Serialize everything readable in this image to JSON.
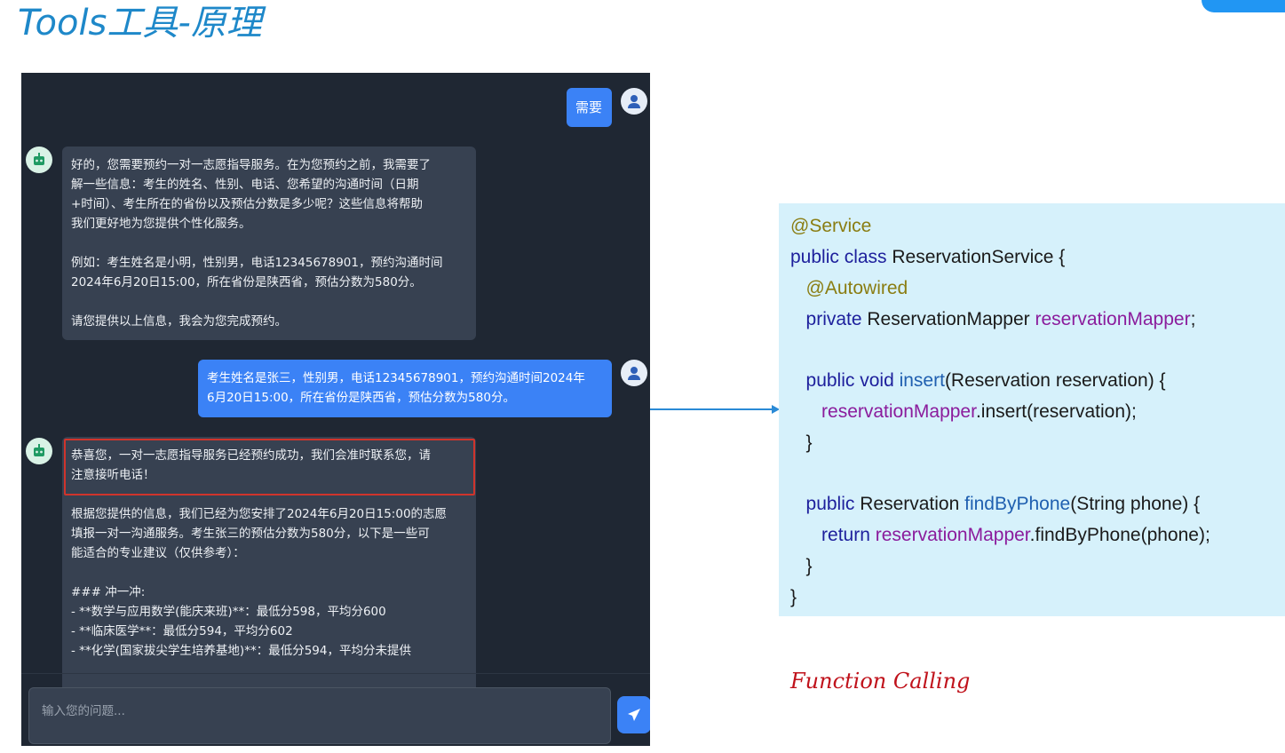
{
  "slide": {
    "title": "Tools工具-原理",
    "function_calling_label": "Function Calling"
  },
  "chat": {
    "messages": [
      {
        "role": "user",
        "text": "需要"
      },
      {
        "role": "assistant",
        "text": "好的，您需要预约一对一志愿指导服务。在为您预约之前，我需要了\n解一些信息：考生的姓名、性别、电话、您希望的沟通时间（日期\n+时间）、考生所在的省份以及预估分数是多少呢？这些信息将帮助\n我们更好地为您提供个性化服务。\n\n例如：考生姓名是小明，性别男，电话12345678901，预约沟通时间\n2024年6月20日15:00，所在省份是陕西省，预估分数为580分。\n\n请您提供以上信息，我会为您完成预约。"
      },
      {
        "role": "user",
        "text": "考生姓名是张三，性别男，电话12345678901，预约沟通时间2024年\n6月20日15:00，所在省份是陕西省，预估分数为580分。"
      },
      {
        "role": "assistant",
        "highlight": "恭喜您，一对一志愿指导服务已经预约成功，我们会准时联系您，请\n注意接听电话！",
        "text": "根据您提供的信息，我们已经为您安排了2024年6月20日15:00的志愿\n填报一对一沟通服务。考生张三的预估分数为580分，以下是一些可\n能适合的专业建议（仅供参考）：\n\n### 冲一冲:\n- **数学与应用数学(能庆来班)**：最低分598，平均分600\n- **临床医学**：最低分594，平均分602\n- **化学(国家拔尖学生培养基地)**：最低分594，平均分未提供"
      }
    ],
    "input_placeholder": "输入您的问题..."
  },
  "code": {
    "lines": [
      [
        {
          "t": "@Service",
          "c": "ann"
        }
      ],
      [
        {
          "t": "public class ",
          "c": "kw"
        },
        {
          "t": "ReservationService {",
          "c": ""
        }
      ],
      [
        {
          "t": "   ",
          "c": ""
        },
        {
          "t": "@Autowired",
          "c": "ann"
        }
      ],
      [
        {
          "t": "   ",
          "c": ""
        },
        {
          "t": "private ",
          "c": "kw"
        },
        {
          "t": "ReservationMapper ",
          "c": ""
        },
        {
          "t": "reservationMapper",
          "c": "fld"
        },
        {
          "t": ";",
          "c": ""
        }
      ],
      [],
      [
        {
          "t": "   ",
          "c": ""
        },
        {
          "t": "public void ",
          "c": "kw"
        },
        {
          "t": "insert",
          "c": "mth"
        },
        {
          "t": "(Reservation reservation) {",
          "c": ""
        }
      ],
      [
        {
          "t": "      ",
          "c": ""
        },
        {
          "t": "reservationMapper",
          "c": "fld"
        },
        {
          "t": ".insert(reservation);",
          "c": ""
        }
      ],
      [
        {
          "t": "   }",
          "c": ""
        }
      ],
      [],
      [
        {
          "t": "   ",
          "c": ""
        },
        {
          "t": "public ",
          "c": "kw"
        },
        {
          "t": "Reservation ",
          "c": ""
        },
        {
          "t": "findByPhone",
          "c": "mth"
        },
        {
          "t": "(String phone) {",
          "c": ""
        }
      ],
      [
        {
          "t": "      ",
          "c": ""
        },
        {
          "t": "return ",
          "c": "kw"
        },
        {
          "t": "reservationMapper",
          "c": "fld"
        },
        {
          "t": ".findByPhone(phone);",
          "c": ""
        }
      ],
      [
        {
          "t": "   }",
          "c": ""
        }
      ],
      [
        {
          "t": "}",
          "c": ""
        }
      ]
    ]
  },
  "colors": {
    "accent": "#3b82f6",
    "chat_bg": "#1f2733",
    "bot_bubble": "#374151",
    "code_bg": "#d6f1fb",
    "highlight_border": "#d0342c",
    "arrow": "#2a8ad6"
  }
}
